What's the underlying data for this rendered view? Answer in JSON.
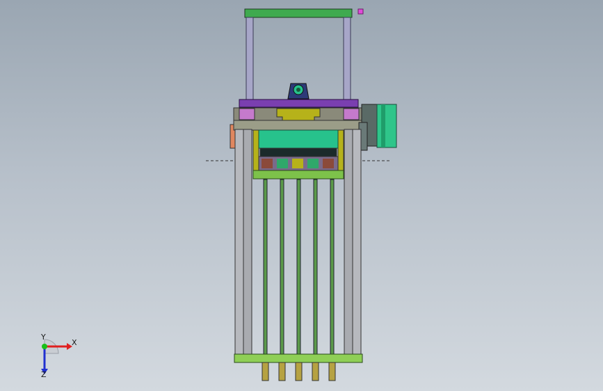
{
  "viewport": {
    "background_top": "#9aa6b2",
    "background_bottom": "#d3d9df"
  },
  "model": {
    "type": "3d-assembly",
    "view": "front",
    "rod_count": 5,
    "colors": {
      "frame_top": "#3faa4f",
      "uprights": "#a7a6c8",
      "crossbar": "#7a3fb0",
      "bracket": "#b6b21a",
      "block": "#27c28c",
      "motor": "#2fc58a",
      "rails": "#b7b9be",
      "rods": "#5b9a4a",
      "base": "#8fcf56",
      "marker": "#e04ad8"
    }
  },
  "triad": {
    "x_label": "X",
    "y_label": "Y",
    "z_label": "Z",
    "x_color": "#e02020",
    "y_color": "#18c018",
    "z_color": "#2030d0"
  }
}
